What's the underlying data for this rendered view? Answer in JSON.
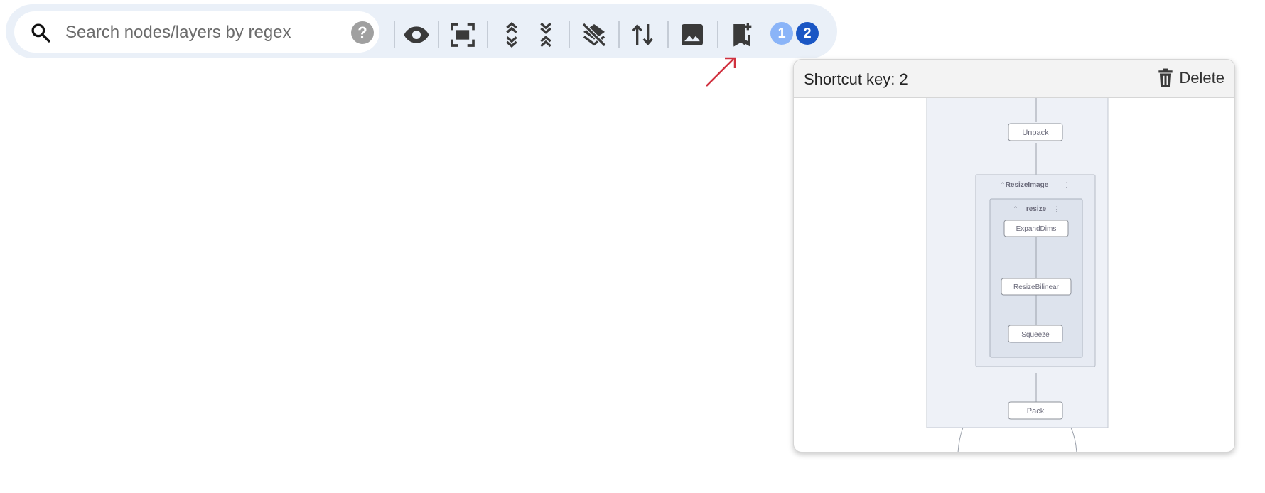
{
  "search": {
    "placeholder": "Search nodes/layers by regex",
    "help_label": "?"
  },
  "toolbar": {
    "icons": [
      "search-icon",
      "eye-icon",
      "fit-screen-icon",
      "expand-all-icon",
      "collapse-all-icon",
      "layers-off-icon",
      "flip-direction-icon",
      "image-icon",
      "bookmark-add-icon"
    ],
    "badges": [
      {
        "label": "1",
        "color": "#8ab4f8"
      },
      {
        "label": "2",
        "color": "#1a56c4"
      }
    ]
  },
  "panel": {
    "title": "Shortcut key: 2",
    "delete_label": "Delete",
    "graph": {
      "nodes": [
        "Unpack",
        "ExpandDims",
        "ResizeBilinear",
        "Squeeze",
        "Pack"
      ],
      "groups": [
        "ResizeImage",
        "resize"
      ]
    }
  },
  "colors": {
    "toolbar_bg": "#eaf0f8",
    "annotation_arrow": "#d0313f",
    "group_outer": "#eef1f7",
    "group_inner": "#e1e6ef"
  }
}
